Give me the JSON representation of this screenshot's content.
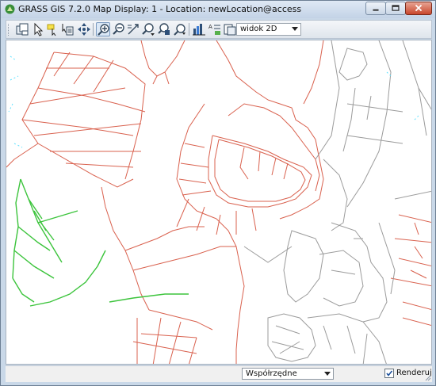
{
  "window": {
    "title": "GRASS GIS 7.2.0 Map Display: 1 - Location: newLocation@access"
  },
  "toolbar": {
    "icons": [
      "add-layer-icon",
      "pointer-icon",
      "highlight-icon",
      "query-icon",
      "pan-icon",
      "zoom-in-icon",
      "zoom-out-icon",
      "zoom-back-icon",
      "zoom-menu-icon",
      "measure-icon",
      "analyze-icon",
      "overlay-icon",
      "legend-icon",
      "decoration-icon",
      "save-icon"
    ],
    "view_mode": "widok 2D"
  },
  "statusbar": {
    "coordinates_label": "Współrzędne",
    "render_label": "Renderuj",
    "render_checked": true
  },
  "colors": {
    "roads": "#d9614e",
    "paths": "#9b9b9b",
    "green": "#3cc43c",
    "cyan": "#5fe1ff"
  }
}
